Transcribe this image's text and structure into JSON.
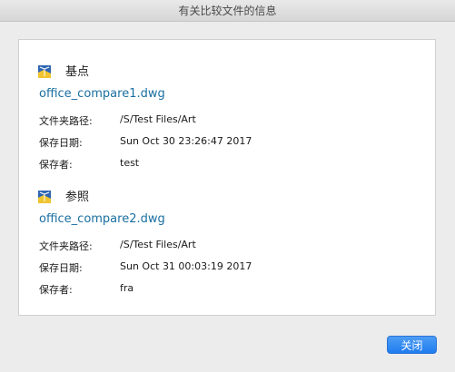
{
  "window": {
    "title": "有关比较文件的信息"
  },
  "base": {
    "heading": "基点",
    "icon": "dwg-file-icon",
    "filename": "office_compare1.dwg",
    "rows": [
      {
        "label": "文件夹路径:",
        "value": "/S/Test Files/Art"
      },
      {
        "label": "保存日期:",
        "value": "Sun Oct 30 23:26:47 2017"
      },
      {
        "label": "保存者:",
        "value": "test"
      }
    ]
  },
  "reference": {
    "heading": "参照",
    "icon": "dwg-file-icon",
    "filename": "office_compare2.dwg",
    "rows": [
      {
        "label": "文件夹路径:",
        "value": "/S/Test Files/Art"
      },
      {
        "label": "保存日期:",
        "value": "Sun Oct 31 00:03:19 2017"
      },
      {
        "label": "保存者:",
        "value": "fra"
      }
    ]
  },
  "buttons": {
    "close_label": "关闭"
  },
  "colors": {
    "filename_link": "#1a6fa0",
    "button_accent": "#1f7cf0"
  }
}
